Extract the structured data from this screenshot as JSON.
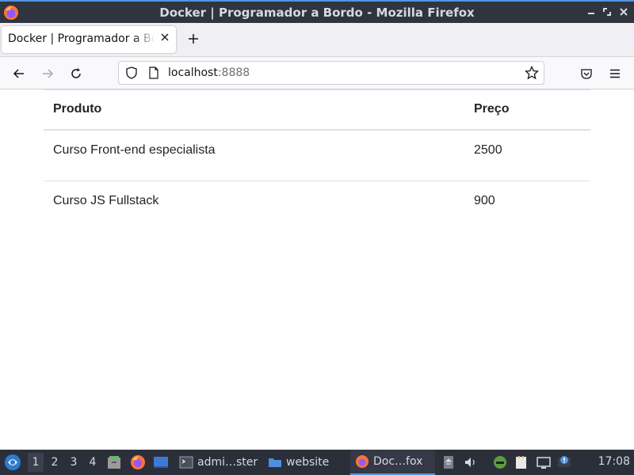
{
  "window": {
    "title": "Docker | Programador a Bordo - Mozilla Firefox",
    "controls": [
      "minimize",
      "maximize",
      "close"
    ]
  },
  "tabs": [
    {
      "title": "Docker | Programador a Bordo",
      "active": true
    }
  ],
  "navbar": {
    "url_host": "localhost",
    "url_port": ":8888"
  },
  "table": {
    "headers": {
      "product": "Produto",
      "price": "Preço"
    },
    "rows": [
      {
        "product": "Curso Front-end especialista",
        "price": "2500"
      },
      {
        "product": "Curso JS Fullstack",
        "price": "900"
      }
    ]
  },
  "taskbar": {
    "workspaces": [
      "1",
      "2",
      "3",
      "4"
    ],
    "active_workspace": "1",
    "tasks": [
      {
        "label": "admi…ster",
        "icon": "terminal-icon"
      },
      {
        "label": "website",
        "icon": "folder-icon"
      },
      {
        "label": "Doc…fox",
        "icon": "firefox-icon",
        "active": true
      }
    ],
    "clock": "17:08"
  },
  "colors": {
    "titlebar_bg": "#2f343f",
    "accent": "#5294e2",
    "taskbar_bg": "#2b2f3a"
  }
}
